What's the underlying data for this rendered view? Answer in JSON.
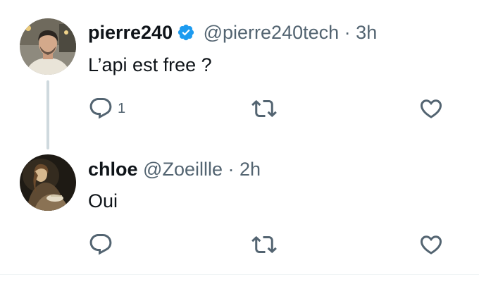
{
  "colors": {
    "text": "#0f1419",
    "secondary": "#536471",
    "verified": "#1d9bf0",
    "thread_line": "#cfd9de"
  },
  "tweets": [
    {
      "name": "pierre240",
      "verified": true,
      "handle": "@pierre240tech",
      "separator": "·",
      "time": "3h",
      "text": "L’api est free ?",
      "reply_count": "1",
      "icons": [
        "reply-icon",
        "retweet-icon",
        "like-icon"
      ]
    },
    {
      "name": "chloe",
      "verified": false,
      "handle": "@Zoeillle",
      "separator": "·",
      "time": "2h",
      "text": "Oui",
      "reply_count": "",
      "icons": [
        "reply-icon",
        "retweet-icon",
        "like-icon"
      ]
    }
  ]
}
